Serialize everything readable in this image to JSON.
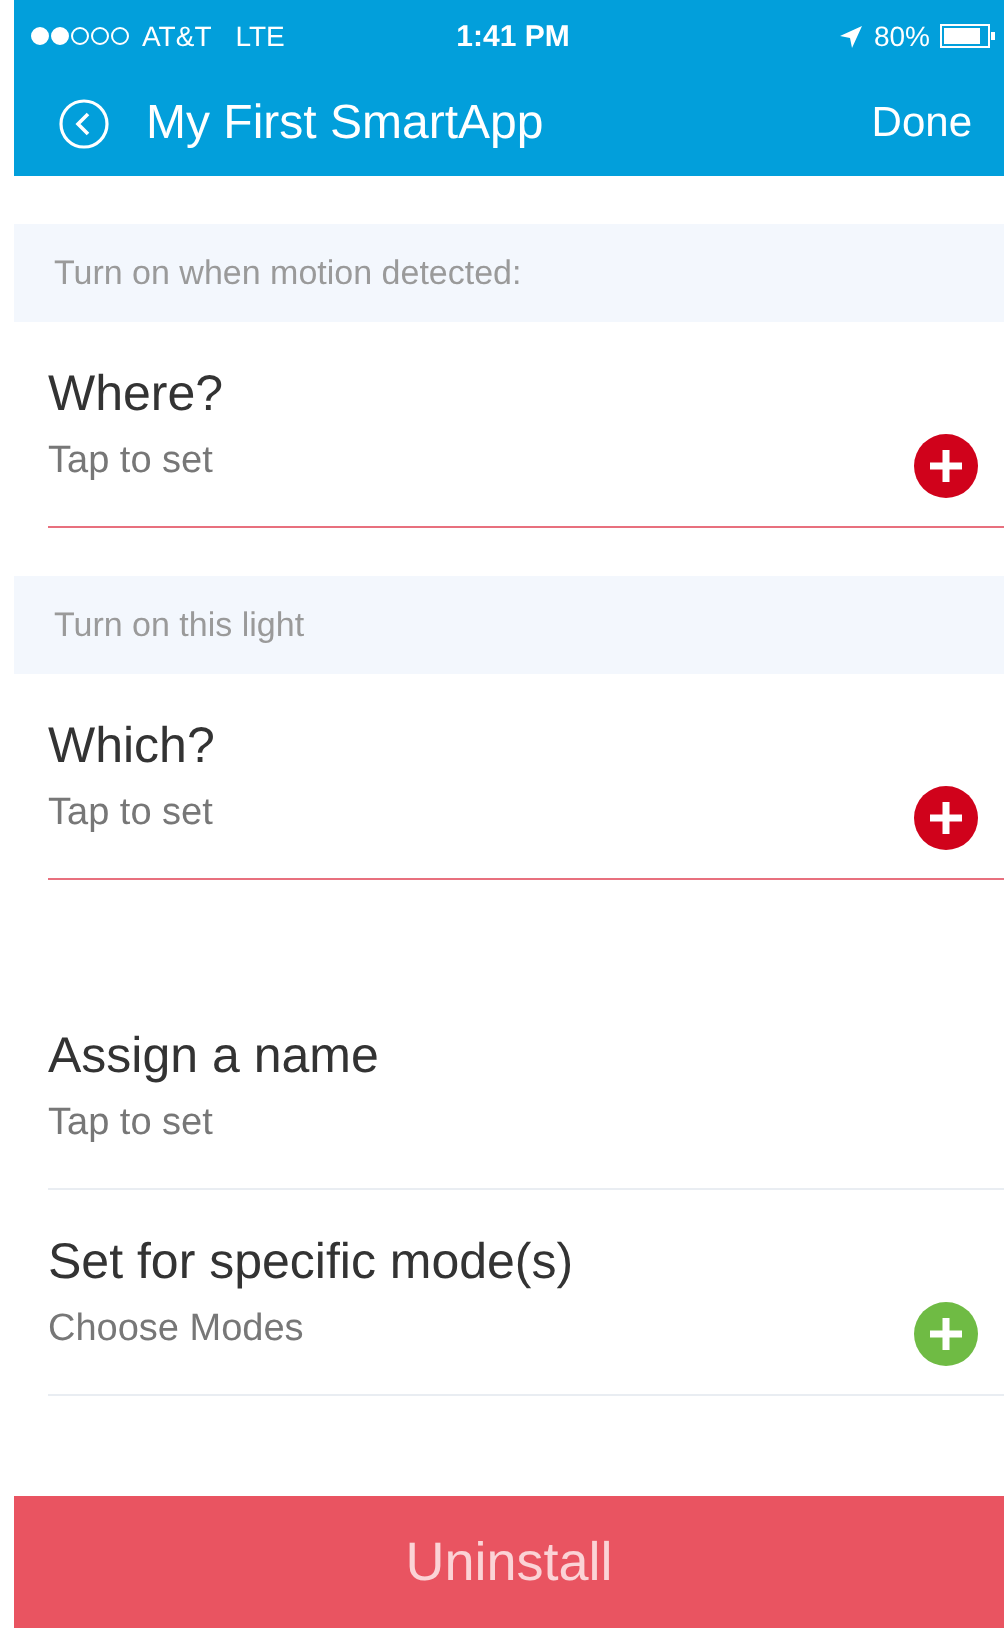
{
  "status_bar": {
    "carrier": "AT&T",
    "network": "LTE",
    "time": "1:41 PM",
    "battery": "80%"
  },
  "nav": {
    "title": "My First SmartApp",
    "done": "Done"
  },
  "groups": [
    {
      "header": "Turn on when motion detected:",
      "items": [
        {
          "title": "Where?",
          "value": "Tap to set",
          "required": true,
          "add": true
        }
      ]
    },
    {
      "header": "Turn on this light",
      "items": [
        {
          "title": "Which?",
          "value": "Tap to set",
          "required": true,
          "add": true
        }
      ]
    },
    {
      "items": [
        {
          "title": "Assign a name",
          "value": "Tap to set",
          "required": false,
          "add": false
        },
        {
          "title": "Set for specific mode(s)",
          "value": "Choose Modes",
          "required": false,
          "add": true
        }
      ]
    }
  ],
  "uninstall": "Uninstall"
}
